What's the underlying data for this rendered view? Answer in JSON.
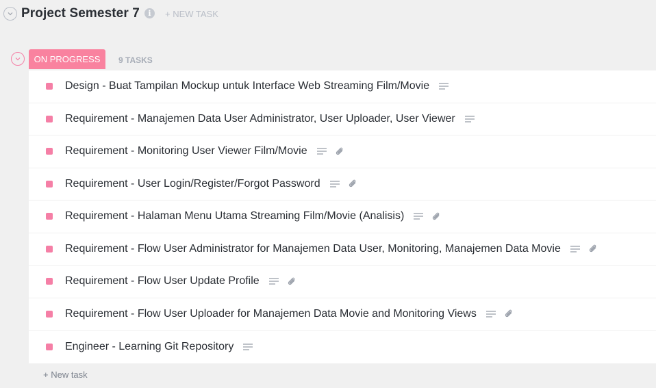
{
  "header": {
    "title": "Project Semester 7",
    "info_icon": "info-icon",
    "new_task_label": "+ NEW TASK"
  },
  "group": {
    "status": "ON PROGRESS",
    "status_color": "#f9829f",
    "count_label": "9 TASKS"
  },
  "tasks": [
    {
      "name": "Design - Buat Tampilan Mockup untuk Interface Web Streaming Film/Movie",
      "has_description": true,
      "has_attachment": false
    },
    {
      "name": "Requirement - Manajemen Data User Administrator, User Uploader, User Viewer",
      "has_description": true,
      "has_attachment": false
    },
    {
      "name": "Requirement - Monitoring User Viewer Film/Movie",
      "has_description": true,
      "has_attachment": true
    },
    {
      "name": "Requirement - User Login/Register/Forgot Password",
      "has_description": true,
      "has_attachment": true
    },
    {
      "name": "Requirement - Halaman Menu Utama Streaming Film/Movie (Analisis)",
      "has_description": true,
      "has_attachment": true
    },
    {
      "name": "Requirement - Flow User Administrator for Manajemen Data User, Monitoring, Manajemen Data Movie",
      "has_description": true,
      "has_attachment": true
    },
    {
      "name": "Requirement - Flow User Update Profile",
      "has_description": true,
      "has_attachment": true
    },
    {
      "name": "Requirement - Flow User Uploader for Manajemen Data Movie and Monitoring Views",
      "has_description": true,
      "has_attachment": true
    },
    {
      "name": "Engineer - Learning Git Repository",
      "has_description": true,
      "has_attachment": false
    }
  ],
  "footer": {
    "new_task_label": "+ New task"
  }
}
